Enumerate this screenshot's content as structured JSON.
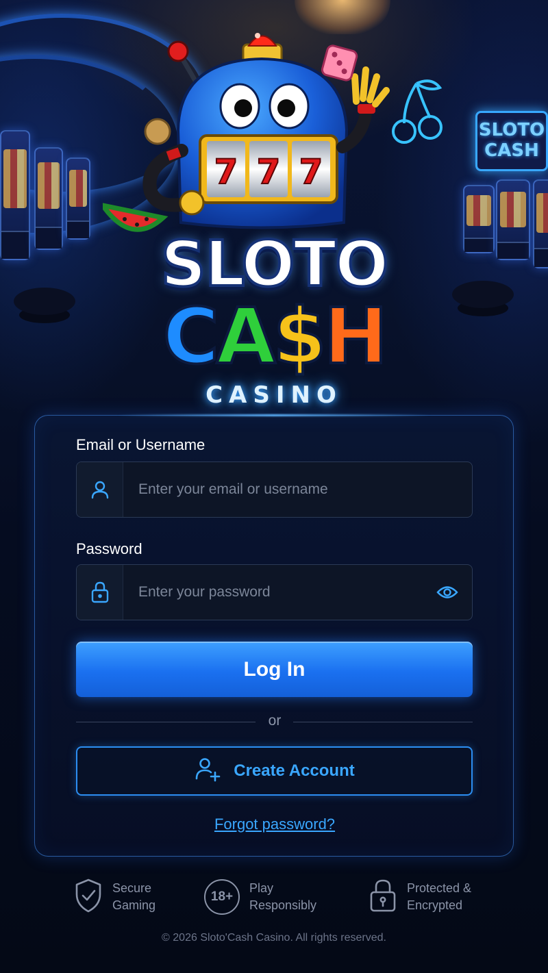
{
  "branding": {
    "logo_line1": "SLOTO",
    "logo_line2": "CA$H",
    "logo_subtitle": "CASINO",
    "sign_text": "SLOTO CASH",
    "reel_text": "777"
  },
  "login_form": {
    "email_label": "Email or Username",
    "email_placeholder": "Enter your email or username",
    "email_icon": "user-icon",
    "password_label": "Password",
    "password_placeholder": "Enter your password",
    "password_icon": "lock-icon",
    "visibility_icon": "eye-icon",
    "login_button": "Log In",
    "divider_text": "or",
    "create_account_button": "Create Account",
    "create_account_icon": "add-user-icon",
    "forgot_password": "Forgot password?"
  },
  "trust_badges": [
    {
      "icon": "shield-check-icon",
      "line1": "Secure",
      "line2": "Gaming"
    },
    {
      "icon": "age-18-plus-icon",
      "icon_text": "18+",
      "line1": "Play",
      "line2": "Responsibly"
    },
    {
      "icon": "padlock-icon",
      "line1": "Protected &",
      "line2": "Encrypted"
    }
  ],
  "footer": {
    "copyright": "© 2026 Sloto'Cash Casino. All rights reserved."
  },
  "colors": {
    "accent": "#2c8ef2",
    "link": "#3aa7ff",
    "background": "#050b1c",
    "button_gradient_top": "#3ea0ff",
    "button_gradient_bottom": "#1460d8"
  }
}
